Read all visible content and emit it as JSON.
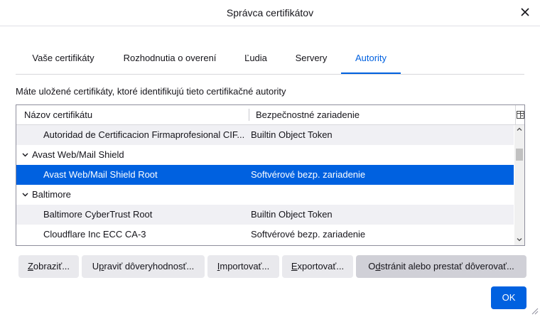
{
  "dialog": {
    "title": "Správca certifikátov"
  },
  "tabs": [
    {
      "label": "Vaše certifikáty",
      "selected": false
    },
    {
      "label": "Rozhodnutia o overení",
      "selected": false
    },
    {
      "label": "Ľudia",
      "selected": false
    },
    {
      "label": "Servery",
      "selected": false
    },
    {
      "label": "Autority",
      "selected": true
    }
  ],
  "description": "Máte uložené certifikáty, ktoré identifikujú tieto certifikačné autority",
  "table": {
    "columns": [
      "Názov certifikátu",
      "Bezpečnostné zariadenie"
    ],
    "rows": [
      {
        "type": "cert",
        "name": "Autoridad de Certificacion Firmaprofesional CIF...",
        "device": "Builtin Object Token",
        "alt": true,
        "selected": false
      },
      {
        "type": "group",
        "name": "Avast Web/Mail Shield",
        "device": "",
        "alt": false,
        "selected": false
      },
      {
        "type": "cert",
        "name": "Avast Web/Mail Shield Root",
        "device": "Softvérové bezp. zariadenie",
        "alt": false,
        "selected": true
      },
      {
        "type": "group",
        "name": "Baltimore",
        "device": "",
        "alt": false,
        "selected": false
      },
      {
        "type": "cert",
        "name": "Baltimore CyberTrust Root",
        "device": "Builtin Object Token",
        "alt": true,
        "selected": false
      },
      {
        "type": "cert",
        "name": "Cloudflare Inc ECC CA-3",
        "device": "Softvérové bezp. zariadenie",
        "alt": false,
        "selected": false
      }
    ]
  },
  "buttons": {
    "view": {
      "accesskey": "Z",
      "rest": "obraziť..."
    },
    "edit_trust": {
      "pre": "U",
      "accesskey": "p",
      "rest": "raviť dôveryhodnosť..."
    },
    "import": {
      "accesskey": "I",
      "rest": "mportovať..."
    },
    "export": {
      "accesskey": "E",
      "rest": "xportovať..."
    },
    "delete": {
      "pre": "O",
      "accesskey": "d",
      "rest": "stránit alebo prestať dôverovať..."
    },
    "ok": "OK"
  },
  "colors": {
    "accent": "#0061e0",
    "selected_text": "#ffffff"
  }
}
